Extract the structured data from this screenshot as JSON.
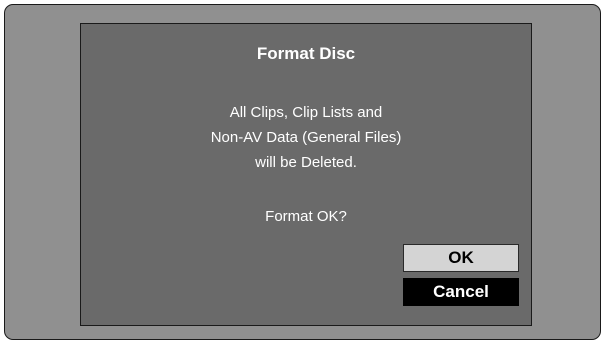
{
  "dialog": {
    "title": "Format Disc",
    "message_lines": [
      "All Clips, Clip Lists and",
      "Non-AV Data (General Files)",
      "will be Deleted."
    ],
    "prompt": "Format OK?",
    "ok_label": "OK",
    "cancel_label": "Cancel",
    "selected": "Cancel"
  },
  "colors": {
    "screen_bg": "#909090",
    "dialog_bg": "#6a6a6a",
    "ok_bg": "#d4d4d4",
    "cancel_bg": "#000000"
  }
}
